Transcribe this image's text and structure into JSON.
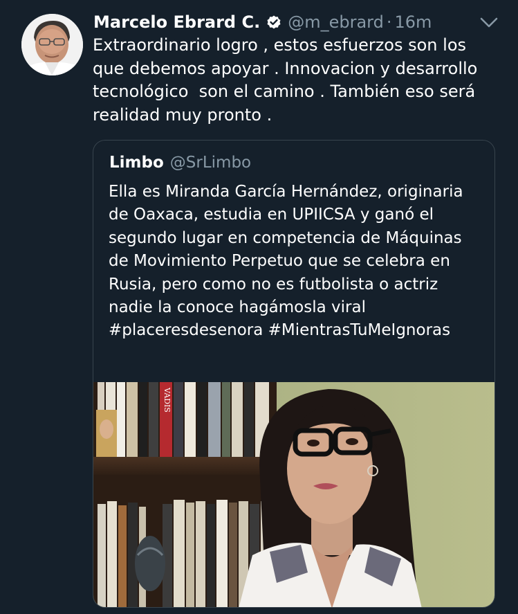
{
  "tweet": {
    "author_name": "Marcelo Ebrard C.",
    "author_handle": "@m_ebrard",
    "separator": "·",
    "timestamp": "16m",
    "text": "Extraordinario logro , estos esfuerzos son los\nque debemos apoyar . Innovacion y desarrollo\ntecnológico  son el camino . También eso será\nrealidad muy pronto .",
    "verified_icon": "verified-badge-icon",
    "menu_icon": "chevron-down-icon"
  },
  "quoted": {
    "author_name": "Limbo",
    "author_handle": "@SrLimbo",
    "text_main": "Ella es Miranda García Hernández, originaria de Oaxaca, estudia en UPIICSA y ganó el segundo lugar en competencia de Máquinas de Movimiento Perpetuo que se celebra en Rusia, pero como no es futbolista o actriz nadie la conoce hagámosla viral ",
    "hashtag_1": "#placeresdesenora",
    "hashtag_2": "#MientrasTuMeIgnoras",
    "image_spine_text": "VADIS"
  },
  "colors": {
    "background": "#15202b",
    "text_primary": "#ffffff",
    "text_secondary": "#8899a6",
    "quote_border": "#38444d"
  }
}
